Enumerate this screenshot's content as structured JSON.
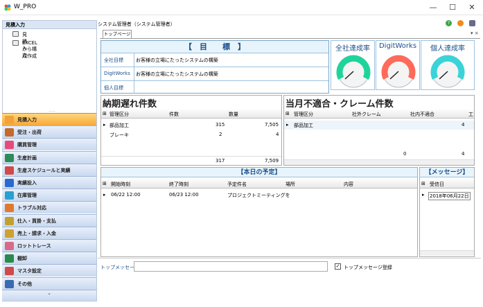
{
  "window": {
    "title": "W_PRO",
    "min": "—",
    "max": "☐",
    "close": "✕"
  },
  "sidebar": {
    "header": "見積入力",
    "collapse": "«",
    "tree": [
      "見積入力",
      "EXCELから構成作成"
    ],
    "nav": [
      "見積入力",
      "受注・出荷",
      "購買管理",
      "生産計画",
      "生産スケジュールと実績",
      "実績投入",
      "在庫管理",
      "トラブル対応",
      "仕入・買掛・支払",
      "売上・請求・入金",
      "ロットトレース",
      "棚卸",
      "マスタ設定",
      "その他"
    ],
    "nav_colors": [
      "#f2a23a",
      "#c46a2a",
      "#e84a7a",
      "#2e8b57",
      "#d04a4a",
      "#2a6ad0",
      "#2aa0d0",
      "#e07a2a",
      "#c0a030",
      "#d0a030",
      "#d86a8a",
      "#2a8a4a",
      "#d04a4a",
      "#3a6ab0"
    ]
  },
  "header": {
    "user": "システム管理者（システム管理者）",
    "tab": "トップページ",
    "pin": "▾ ×"
  },
  "goals": {
    "title": "【　目　　標　】",
    "rows": [
      {
        "label": "全社目標",
        "text": "お客様の立場にたったシステムの構築"
      },
      {
        "label": "DigitWorks",
        "text": "お客様の立場にたったシステムの構築"
      },
      {
        "label": "個人目標",
        "text": ""
      }
    ],
    "gauges": [
      {
        "title": "全社達成率",
        "color": "#1fd49a"
      },
      {
        "title": "DigitWorks",
        "color": "#ff6a5a"
      },
      {
        "title": "個人達成率",
        "color": "#3ad3d8"
      }
    ]
  },
  "late": {
    "title": "納期遅れ件数",
    "headers": [
      "管理区分",
      "件数",
      "数量"
    ],
    "rows": [
      {
        "a": "部品加工",
        "b": "315",
        "c": "7,505"
      },
      {
        "a": "ブレーキ",
        "b": "2",
        "c": "4"
      }
    ],
    "totals": {
      "b": "317",
      "c": "7,509"
    }
  },
  "nonconf": {
    "title": "当月不適合・クレーム件数",
    "headers": [
      "管理区分",
      "社外クレーム",
      "社内不適合",
      "工"
    ],
    "rows": [
      {
        "a": "部品加工",
        "b": "",
        "c": "4"
      }
    ],
    "totals": {
      "b": "0",
      "c": "4"
    }
  },
  "schedule": {
    "title": "【本日の予定】",
    "headers": [
      "開始時刻",
      "終了時刻",
      "予定件名",
      "場所",
      "内容"
    ],
    "rows": [
      {
        "start": "06/22 12:00",
        "end": "06/23 12:00",
        "subject": "プロジェクトミーティングを",
        "place": "",
        "body": ""
      }
    ]
  },
  "message": {
    "title": "【メッセージ】",
    "header": "受信日",
    "rows": [
      "2018年06月22日"
    ]
  },
  "bottom": {
    "label": "トップメッセージ",
    "input": "",
    "checkbox_label": "トップメッセージ登録"
  }
}
